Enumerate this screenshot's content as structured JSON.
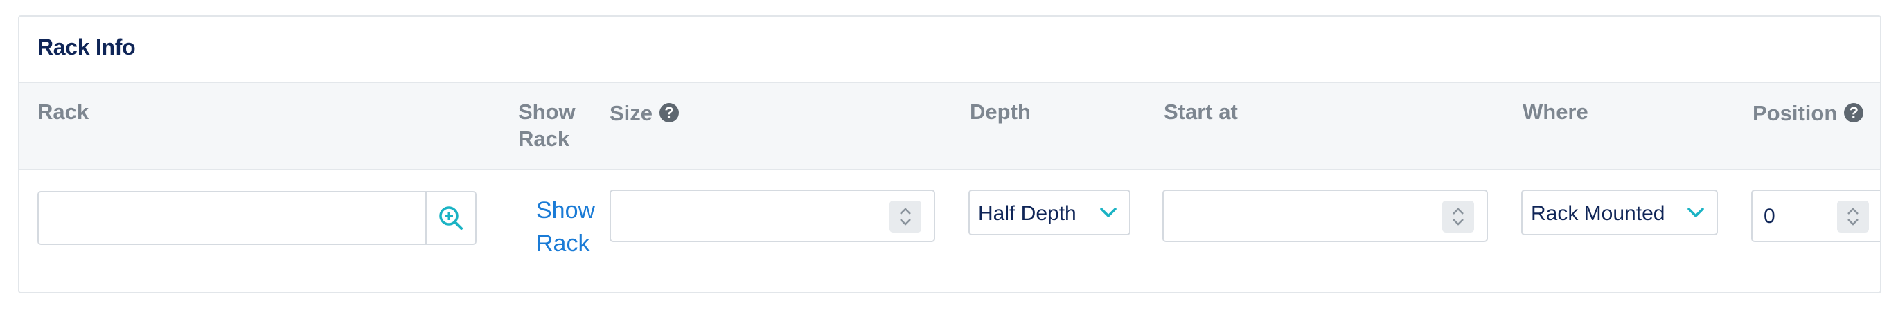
{
  "panel": {
    "title": "Rack Info"
  },
  "columns": {
    "rack": "Rack",
    "show_rack": "Show Rack",
    "size": "Size",
    "depth": "Depth",
    "start_at": "Start at",
    "where": "Where",
    "position": "Position"
  },
  "fields": {
    "rack_value": "",
    "show_rack_link": "Show Rack",
    "size_value": "",
    "depth_selected": "Half Depth",
    "start_at_value": "",
    "where_selected": "Rack Mounted",
    "position_value": "0"
  },
  "icons": {
    "help": "question-circle-icon",
    "lookup": "zoom-in-icon",
    "chevron": "chevron-down-icon",
    "stepper": "up-down-stepper-icon"
  },
  "colors": {
    "title": "#0f2557",
    "header_text": "#7d8690",
    "link": "#1a7bd6",
    "accent": "#1ab3c4",
    "header_bg": "#f5f7f9"
  }
}
